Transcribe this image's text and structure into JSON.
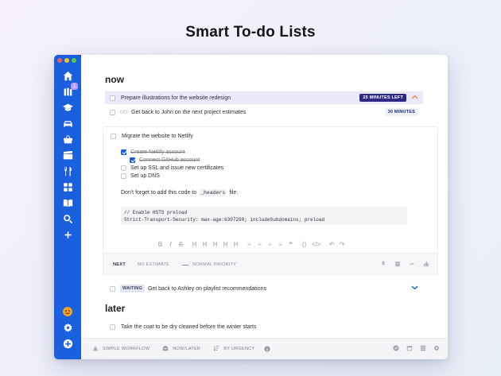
{
  "headline": "Smart To-do Lists",
  "colors": {
    "accent": "#1a60de",
    "pill": "#2e2a84",
    "highlight": "#ece8fb",
    "avatar": "#f0a12b"
  },
  "window": {
    "traffic_lights": [
      "#ee5f57",
      "#f5be2f",
      "#5dc74b"
    ]
  },
  "sidebar": {
    "items": [
      {
        "icon": "home-icon"
      },
      {
        "icon": "inbox-icon",
        "badge": "1"
      },
      {
        "icon": "graduation-cap-icon"
      },
      {
        "icon": "car-icon"
      },
      {
        "icon": "basket-icon"
      },
      {
        "icon": "clapperboard-icon"
      },
      {
        "icon": "utensils-icon"
      },
      {
        "icon": "grid-icon"
      },
      {
        "icon": "book-icon"
      },
      {
        "icon": "search-icon"
      },
      {
        "icon": "plus-icon"
      }
    ],
    "bottom_items": [
      {
        "icon": "avatar-icon"
      },
      {
        "icon": "gear-icon"
      },
      {
        "icon": "add-circle-icon"
      }
    ]
  },
  "sections": {
    "now": "now",
    "later": "later"
  },
  "tasks": {
    "t1": {
      "title": "Prepare illustrations for the website redesign",
      "time": "25 MINUTES LEFT"
    },
    "t2": {
      "title": "Get back to John on the next project estimates",
      "time": "30 MINUTES"
    },
    "t3": {
      "title": "Migrate the website to Netlify",
      "subtasks": [
        {
          "title": "Create Netlify account",
          "done": true
        },
        {
          "title": "Connect GitHub account",
          "done": true
        },
        {
          "title": "Set up SSL and issue new certificates",
          "done": false
        },
        {
          "title": "Set up DNS",
          "done": false
        }
      ],
      "note_before": "Don't forget to add this code to",
      "note_code": "_headers",
      "note_after": "file:",
      "code_lines": [
        "// Enable HSTS preload",
        "Strict-Transport-Security: max-age:6307200; includeSubdomains; preload"
      ],
      "format_buttons": [
        "B",
        "I",
        "S",
        "H",
        "H",
        "H",
        "H",
        "H",
        "≡",
        "≡",
        "≡",
        "≡",
        "❝",
        "⟨⟩",
        "</>",
        "↶",
        "↷"
      ],
      "footer": {
        "next": "NEXT",
        "estimate": "NO ESTIMATE",
        "priority": "NORMAL PRIORITY"
      }
    },
    "t4": {
      "tag": "WAITING",
      "title": "Get back to Ashley on playlist recommendations"
    },
    "t5": {
      "title": "Take the coat to be dry cleaned before the winter starts"
    }
  },
  "bottom_bar": {
    "workflow": "SIMPLE WORKFLOW",
    "nowlater": "NOW/LATER",
    "sort": "BY URGENCY"
  }
}
